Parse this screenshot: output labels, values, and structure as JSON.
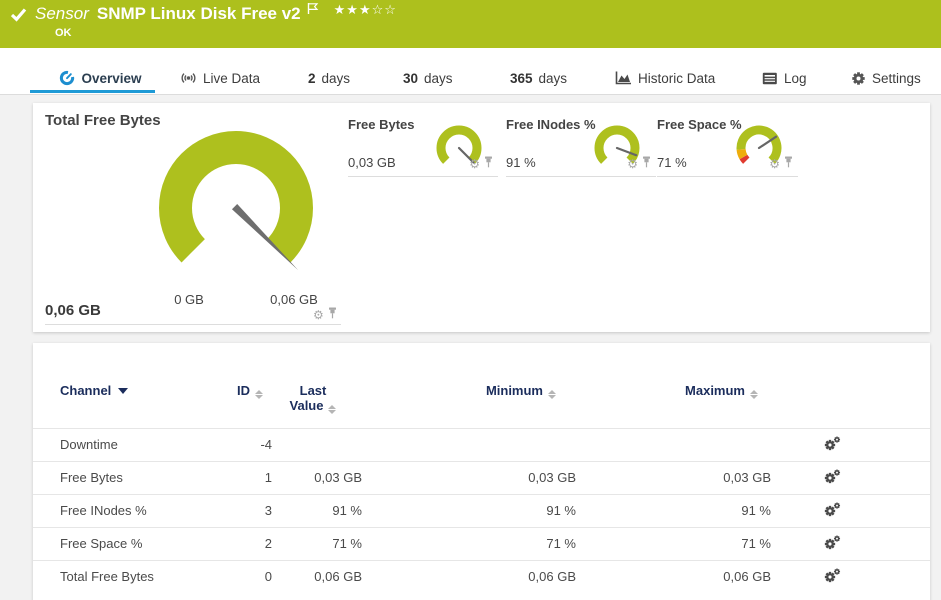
{
  "header": {
    "type_label": "Sensor",
    "title": "SNMP Linux Disk Free v2",
    "status": "OK",
    "rating_filled": 3,
    "rating_total": 5,
    "background_color": "#adc01d"
  },
  "tabs": [
    {
      "id": "overview",
      "label": "Overview",
      "icon": "gauge-icon",
      "active": true
    },
    {
      "id": "live-data",
      "label": "Live Data",
      "icon": "live-data-icon",
      "active": false
    },
    {
      "id": "2-days",
      "number": "2",
      "label": "days",
      "active": false
    },
    {
      "id": "30-days",
      "number": "30",
      "label": "days",
      "active": false
    },
    {
      "id": "365-days",
      "number": "365",
      "label": "days",
      "active": false
    },
    {
      "id": "historic-data",
      "label": "Historic Data",
      "icon": "historic-data-icon",
      "active": false
    },
    {
      "id": "log",
      "label": "Log",
      "icon": "log-icon",
      "active": false
    },
    {
      "id": "settings",
      "label": "Settings",
      "icon": "settings-icon",
      "active": false
    }
  ],
  "gauges": {
    "main": {
      "title": "Total Free Bytes",
      "value": "0,06 GB",
      "scale_min": "0 GB",
      "scale_max": "0,06 GB",
      "fraction": 1.0,
      "color": "#aec01e"
    },
    "mini": [
      {
        "title": "Free Bytes",
        "value": "0,03 GB",
        "fraction": 1.0,
        "zones": [
          {
            "from": 0,
            "to": 1,
            "color": "#aec01e"
          }
        ]
      },
      {
        "title": "Free INodes %",
        "value": "91 %",
        "fraction": 0.91,
        "zones": [
          {
            "from": 0,
            "to": 1,
            "color": "#aec01e"
          }
        ]
      },
      {
        "title": "Free Space %",
        "value": "71 %",
        "fraction": 0.71,
        "zones": [
          {
            "from": 0,
            "to": 0.055,
            "color": "#e03a2f"
          },
          {
            "from": 0.055,
            "to": 0.15,
            "color": "#eead0c"
          },
          {
            "from": 0.15,
            "to": 1,
            "color": "#aec01e"
          }
        ]
      }
    ]
  },
  "table": {
    "columns": [
      "Channel",
      "ID",
      "Last Value",
      "Minimum",
      "Maximum"
    ],
    "sorted_by": "Channel",
    "rows": [
      {
        "channel": "Downtime",
        "id": "-4",
        "last": "",
        "min": "",
        "max": ""
      },
      {
        "channel": "Free Bytes",
        "id": "1",
        "last": "0,03 GB",
        "min": "0,03 GB",
        "max": "0,03 GB"
      },
      {
        "channel": "Free INodes %",
        "id": "3",
        "last": "91 %",
        "min": "91 %",
        "max": "91 %"
      },
      {
        "channel": "Free Space %",
        "id": "2",
        "last": "71 %",
        "min": "71 %",
        "max": "71 %"
      },
      {
        "channel": "Total Free Bytes",
        "id": "0",
        "last": "0,06 GB",
        "min": "0,06 GB",
        "max": "0,06 GB"
      }
    ]
  },
  "colors": {
    "accent_green": "#adc01d",
    "gauge_green": "#aec01e",
    "active_tab_blue": "#1e9ad6",
    "table_header_navy": "#1b2d5c",
    "needle_gray": "#6e6e6e"
  }
}
